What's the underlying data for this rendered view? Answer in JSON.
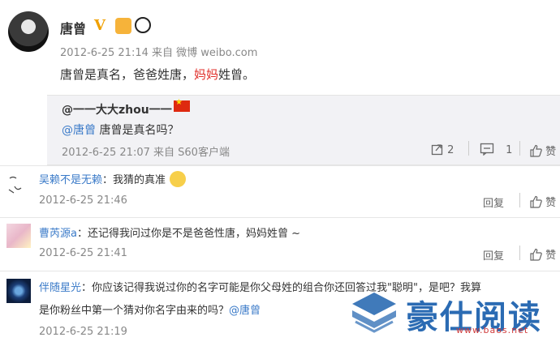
{
  "post": {
    "author": "唐曾",
    "time": "2012-6-25 21:14",
    "source_prefix": "来自",
    "source": "微博 weibo.com",
    "text_part1": "唐曾是真名，爸爸姓唐，",
    "text_highlight": "妈妈",
    "text_part2": "姓曾。"
  },
  "quoted": {
    "author": "@一一大大zhou一一",
    "mention": "@唐曾",
    "text": " 唐曾是真名吗？",
    "time": "2012-6-25 21:07",
    "source": "来自 S60客户端",
    "repost_count": "2",
    "comment_count": "1",
    "like_label": "赞"
  },
  "comments": [
    {
      "user": "吴赖不是无赖",
      "text": "：我猜的真准",
      "time": "2012-6-25 21:46",
      "reply_label": "回复",
      "like_label": "赞"
    },
    {
      "user": "曹芮源a",
      "text": "：还记得我问过你是不是爸爸性唐，妈妈姓曾 ~",
      "time": "2012-6-25 21:41",
      "reply_label": "回复",
      "like_label": "赞"
    },
    {
      "user": "伴随星光",
      "text": "：你应该记得我说过你的名字可能是你父母姓的组合",
      "text_overflow": "你还回答过我\"聪明\"，是吧？我算",
      "line2_prefix": "是你粉丝中第一个猜对你名字由来的吗？",
      "line2_mention": "@唐曾",
      "time": "2012-6-25 21:19"
    }
  ],
  "watermark": {
    "text": "豪仕阅读",
    "sub": "www.baos.net"
  },
  "colors": {
    "link": "#3a7ac8",
    "highlight": "#e0302b",
    "quote_bg": "#f2f2f5"
  }
}
